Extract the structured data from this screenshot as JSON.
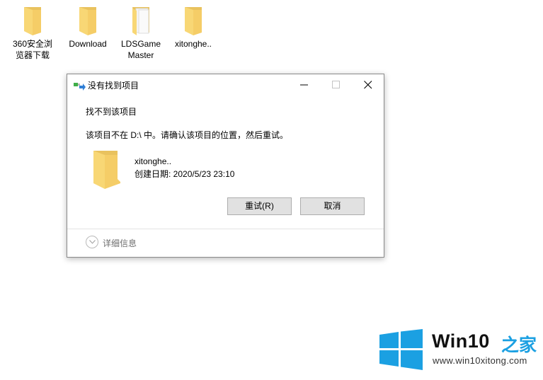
{
  "desktop": {
    "icons": [
      {
        "label_line1": "360安全浏",
        "label_line2": "览器下载",
        "icon": "folder-icon"
      },
      {
        "label_line1": "Download",
        "label_line2": "",
        "icon": "folder-icon"
      },
      {
        "label_line1": "LDSGame",
        "label_line2": "Master",
        "icon": "folder-with-documents-icon"
      },
      {
        "label_line1": "xitonghe..",
        "label_line2": "",
        "icon": "folder-icon"
      }
    ]
  },
  "dialog": {
    "title": "没有找到项目",
    "title_icon": "move-file-icon",
    "controls": {
      "minimize": "minimize-icon",
      "maximize": "maximize-icon",
      "close": "close-icon"
    },
    "heading": "找不到该项目",
    "message": "该项目不在 D:\\ 中。请确认该项目的位置，然后重试。",
    "item": {
      "name": "xitonghe..",
      "created": "创建日期: 2020/5/23 23:10",
      "icon": "folder-icon"
    },
    "buttons": {
      "retry": "重试(R)",
      "cancel": "取消"
    },
    "details_label": "详细信息"
  },
  "watermark": {
    "brand": "Win10",
    "brand_cn": "之家",
    "url": "www.win10xitong.com",
    "accent_color": "#1ba0e2"
  }
}
